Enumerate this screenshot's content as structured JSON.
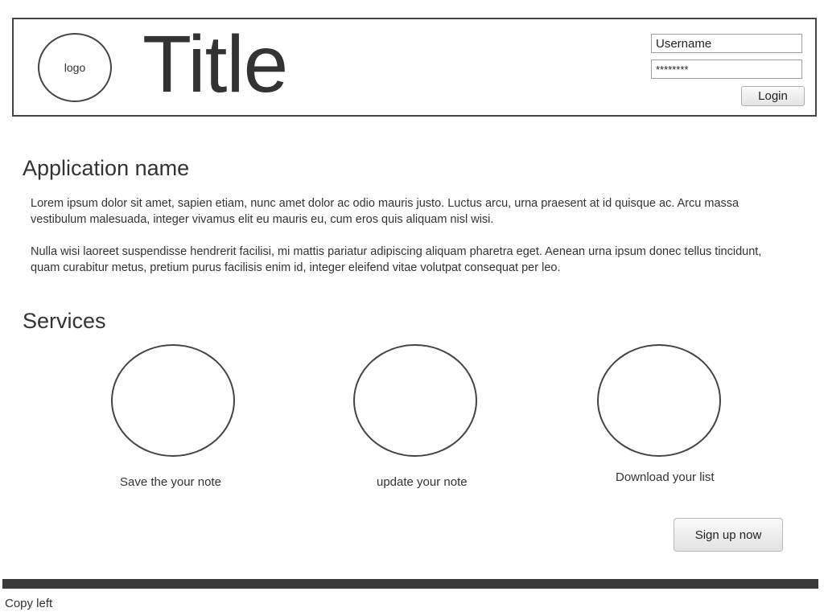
{
  "header": {
    "logo_text": "logo",
    "title": "Title",
    "login": {
      "username_value": "Username",
      "password_value": "********",
      "button_label": "Login"
    }
  },
  "main": {
    "app_name": "Application name",
    "paragraphs": [
      "Lorem ipsum dolor sit amet, sapien etiam, nunc amet dolor ac odio mauris justo. Luctus arcu, urna praesent at id quisque ac. Arcu massa vestibulum malesuada, integer vivamus elit eu mauris eu, cum eros quis aliquam nisl wisi.",
      "Nulla wisi laoreet suspendisse hendrerit facilisi, mi mattis pariatur adipiscing aliquam pharetra eget. Aenean urna ipsum donec tellus tincidunt, quam curabitur metus, pretium purus facilisis enim id, integer eleifend vitae volutpat consequat per leo."
    ],
    "services_heading": "Services",
    "services": [
      {
        "label": "Save the your note"
      },
      {
        "label": "update your note"
      },
      {
        "label": "Download your list"
      }
    ],
    "signup_label": "Sign up now"
  },
  "footer": {
    "text": "Copy left"
  },
  "colors": {
    "text": "#333333",
    "border": "#444444",
    "footer_bar": "#3a3a3a"
  }
}
